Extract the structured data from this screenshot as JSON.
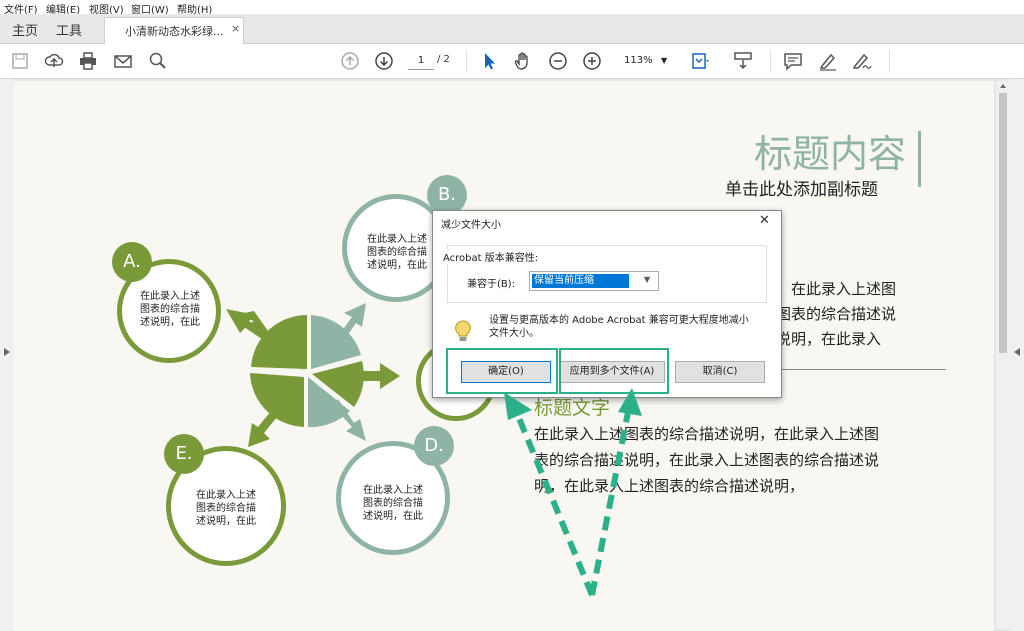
{
  "menu": [
    "文件(F)",
    "编辑(E)",
    "视图(V)",
    "窗口(W)",
    "帮助(H)"
  ],
  "tabs": {
    "home": "主页",
    "tools": "工具",
    "document": "小清新动态水彩绿...",
    "close": "×"
  },
  "toolbar": {
    "page_current": "1",
    "page_total": "/ 2",
    "zoom": "113%"
  },
  "slide": {
    "title": "标题内容",
    "subtitle": "单击此处添加副标题",
    "body_right_lines": [
      "，在此录入上述图",
      "图表的综合描述说",
      "说明，在此录入"
    ],
    "heading2": "标题文字",
    "body2_lines": [
      "在此录入上述图表的综合描述说明，在此录入上述图",
      "表的综合描述说明，在此录入上述图表的综合描述说",
      "明，在此录入上述图表的综合描述说明，"
    ],
    "circles": [
      {
        "badge": "A.",
        "text": "在此录入上述\n图表的综合描\n述说明，在此"
      },
      {
        "badge": "B.",
        "text": "在此录入上述\n图表的综合描\n述说明，在此"
      },
      {
        "badge": "D.",
        "text": "在此录入上述\n图表的综合描\n述说明，在此"
      },
      {
        "badge": "E.",
        "text": "在此录入上述\n图表的综合描\n述说明，在此"
      }
    ]
  },
  "dialog": {
    "title": "减少文件大小",
    "close": "✕",
    "group_label": "Acrobat 版本兼容性:",
    "compat_label": "兼容于(B):",
    "compat_value": "保留当前压缩",
    "hint": "设置与更高版本的 Adobe Acrobat 兼容可更大程度地减小文件大小。",
    "ok": "确定(O)",
    "apply": "应用到多个文件(A)",
    "cancel": "取消(C)"
  },
  "colors": {
    "green": "#7a9a3a",
    "teal": "#8fb4a6",
    "highlight": "#2bb08a"
  }
}
